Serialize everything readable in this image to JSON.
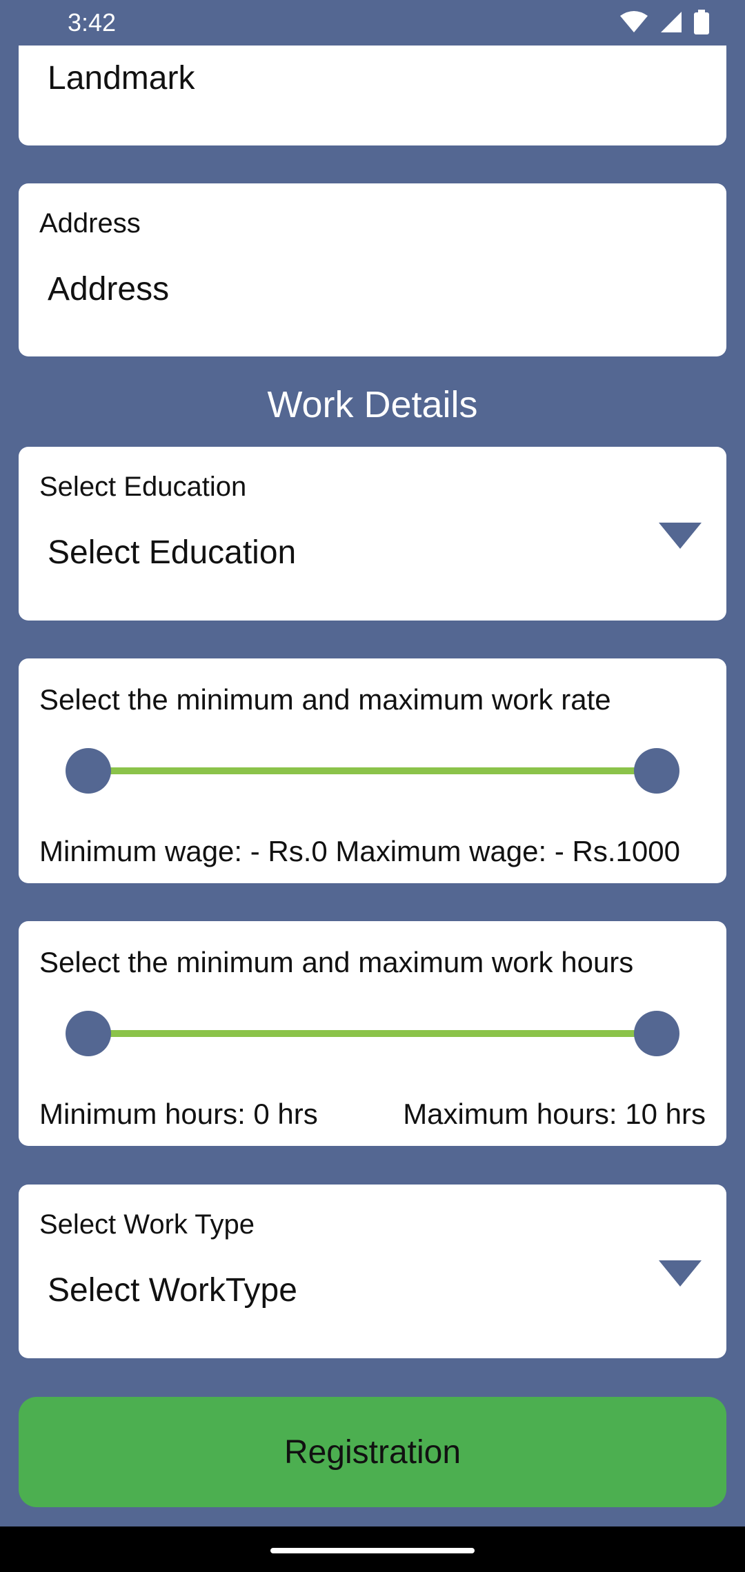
{
  "status_bar": {
    "time": "3:42"
  },
  "landmark": {
    "value": "Landmark"
  },
  "address": {
    "label": "Address",
    "value": "Address"
  },
  "section": {
    "title": "Work Details"
  },
  "education": {
    "label": "Select Education",
    "selected": "Select Education"
  },
  "work_rate": {
    "title": "Select the minimum and maximum work rate",
    "caption": "Minimum wage: - Rs.0 Maximum wage: - Rs.1000",
    "min": 0,
    "max": 1000
  },
  "work_hours": {
    "title": "Select the minimum and maximum work hours",
    "min_caption": "Minimum hours: 0 hrs",
    "max_caption": "Maximum hours: 10 hrs",
    "min": 0,
    "max": 10
  },
  "work_type": {
    "label": "Select Work Type",
    "selected": "Select WorkType"
  },
  "register_button": {
    "label": "Registration"
  },
  "colors": {
    "primary": "#546792",
    "accent": "#8bc34a",
    "button": "#4caf50"
  }
}
